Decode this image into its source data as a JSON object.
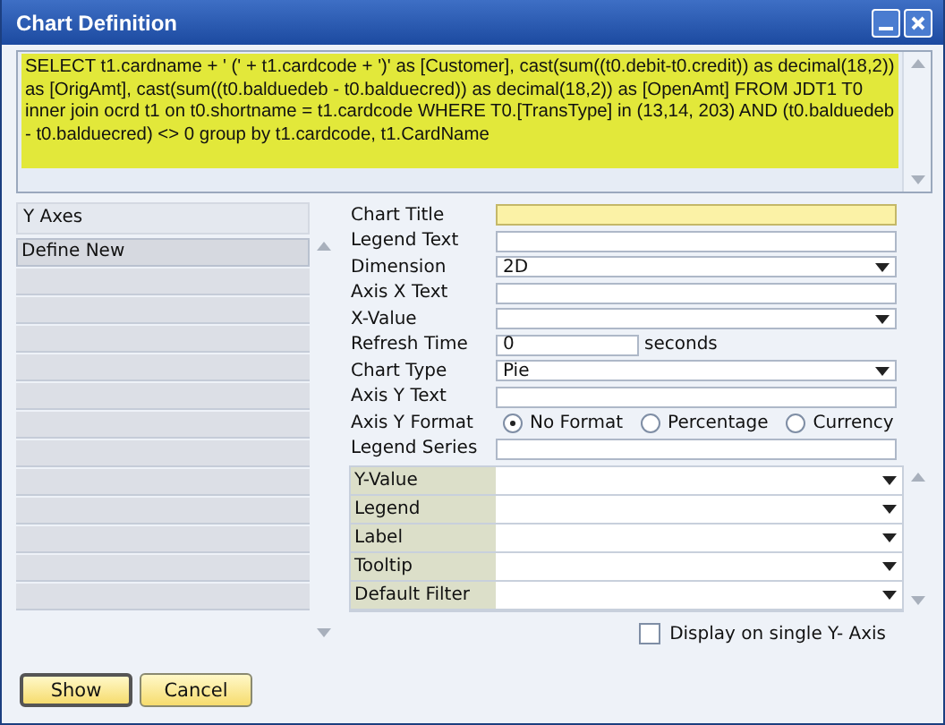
{
  "window": {
    "title": "Chart Definition"
  },
  "query": {
    "value": "SELECT t1.cardname + ' (' + t1.cardcode + ')' as [Customer], cast(sum((t0.debit-t0.credit)) as decimal(18,2)) as [OrigAmt], cast(sum((t0.balduedeb - t0.balduecred)) as decimal(18,2)) as [OpenAmt] FROM JDT1 T0 inner join ocrd t1 on t0.shortname = t1.cardcode WHERE T0.[TransType] in (13,14, 203) AND (t0.balduedeb - t0.balduecred) <> 0 group by t1.cardcode, t1.CardName"
  },
  "y_axes": {
    "header": "Y Axes",
    "items": [
      {
        "label": "Define New"
      }
    ]
  },
  "fields": [
    {
      "kind": "text",
      "label": "Chart Title",
      "focused": true
    },
    {
      "kind": "text",
      "label": "Legend Text",
      "focused": false
    },
    {
      "kind": "select",
      "label": "Dimension",
      "value": "2D"
    },
    {
      "kind": "text",
      "label": "Axis X Text",
      "focused": false
    },
    {
      "kind": "select",
      "label": "X-Value"
    },
    {
      "kind": "number",
      "label": "Refresh Time",
      "value": "0",
      "unit": "seconds"
    },
    {
      "kind": "select",
      "label": "Chart Type",
      "value": "Pie"
    },
    {
      "kind": "text",
      "label": "Axis Y Text",
      "focused": false
    },
    {
      "kind": "radio",
      "label": "Axis Y Format",
      "options": [
        {
          "label": "No Format",
          "selected": true
        },
        {
          "label": "Percentage",
          "selected": false
        },
        {
          "label": "Currency",
          "selected": false
        }
      ]
    },
    {
      "kind": "text",
      "label": "Legend Series",
      "focused": false
    }
  ],
  "series_grid": [
    {
      "label": "Y-Value"
    },
    {
      "label": "Legend"
    },
    {
      "label": "Label"
    },
    {
      "label": "Tooltip"
    },
    {
      "label": "Default Filter"
    }
  ],
  "single_axis": {
    "label": "Display on single Y- Axis",
    "checked": false
  },
  "buttons": [
    {
      "label": "Show",
      "kind": "default"
    },
    {
      "label": "Cancel",
      "kind": "normal"
    }
  ]
}
